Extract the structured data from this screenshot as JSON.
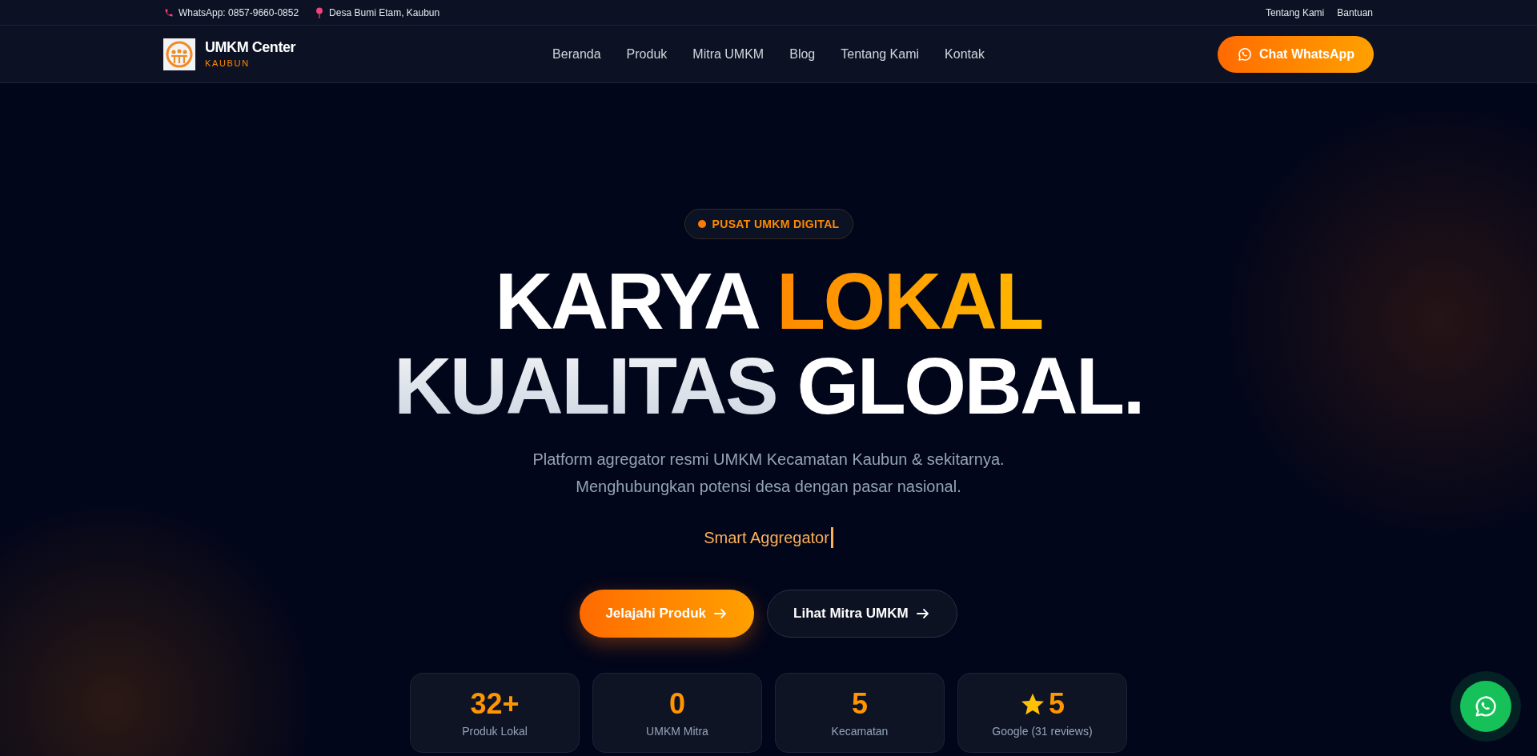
{
  "top_bar": {
    "contacts": [
      {
        "kind": "phone",
        "text": "WhatsApp: 0857-9660-0852"
      },
      {
        "kind": "location",
        "text": "Desa Bumi Etam, Kaubun"
      }
    ],
    "links": [
      "Tentang Kami",
      "Bantuan"
    ]
  },
  "nav": {
    "brand": {
      "name": "UMKM Center",
      "sub": "KAUBUN"
    },
    "items": [
      {
        "label": "Beranda",
        "selected": false
      },
      {
        "label": "Produk",
        "selected": false
      },
      {
        "label": "Mitra UMKM",
        "selected": false
      },
      {
        "label": "Blog",
        "selected": false
      },
      {
        "label": "Tentang Kami",
        "selected": false
      },
      {
        "label": "Kontak",
        "selected": false
      }
    ],
    "cta": "Chat WhatsApp"
  },
  "hero": {
    "badge": "PUSAT UMKM DIGITAL",
    "headline": [
      [
        {
          "text": "KARYA ",
          "kind": "plain"
        },
        {
          "text": "LOKAL",
          "kind": "accent"
        }
      ],
      [
        {
          "text": "KUALITAS ",
          "kind": "muted"
        },
        {
          "text": "GLOBAL.",
          "kind": "plain"
        }
      ]
    ],
    "subtitle": [
      "Platform agregator resmi UMKM Kecamatan Kaubun & sekitarnya.",
      "Menghubungkan potensi desa dengan pasar nasional."
    ],
    "typed": "Smart Aggregator",
    "buttons": [
      {
        "label": "Jelajahi Produk",
        "kind": "primary"
      },
      {
        "label": "Lihat Mitra UMKM",
        "kind": "secondary"
      }
    ],
    "stats": [
      {
        "value": "32+",
        "label": "Produk Lokal",
        "star": false
      },
      {
        "value": "0",
        "label": "UMKM Mitra",
        "star": false
      },
      {
        "value": "5",
        "label": "Kecamatan",
        "star": false
      },
      {
        "value": "5",
        "label": "Google (31 reviews)",
        "star": true
      }
    ]
  }
}
